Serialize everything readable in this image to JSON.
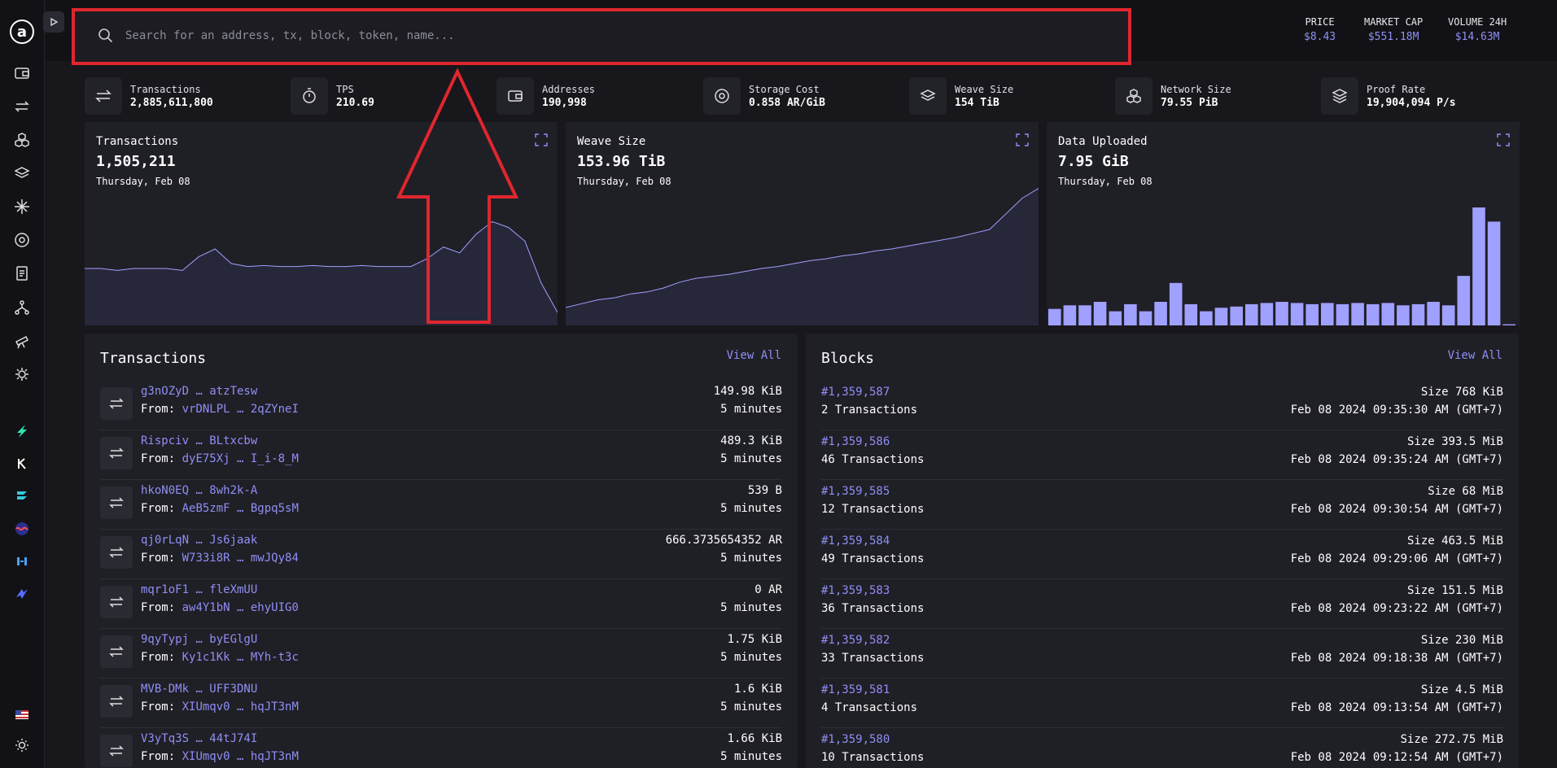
{
  "app": {
    "logo_letter": "a"
  },
  "search": {
    "placeholder": "Search for an address, tx, block, token, name..."
  },
  "market": {
    "price_label": "PRICE",
    "price_value": "$8.43",
    "cap_label": "MARKET CAP",
    "cap_value": "$551.18M",
    "volume_label": "VOLUME 24H",
    "volume_value": "$14.63M"
  },
  "stats": [
    {
      "label": "Transactions",
      "value": "2,885,611,800",
      "icon": "transfer-icon"
    },
    {
      "label": "TPS",
      "value": "210.69",
      "icon": "stopwatch-icon"
    },
    {
      "label": "Addresses",
      "value": "190,998",
      "icon": "wallet-icon"
    },
    {
      "label": "Storage Cost",
      "value": "0.858 AR/GiB",
      "icon": "coin-icon"
    },
    {
      "label": "Weave Size",
      "value": "154 TiB",
      "icon": "layers-icon"
    },
    {
      "label": "Network Size",
      "value": "79.55 PiB",
      "icon": "cubes-icon"
    },
    {
      "label": "Proof Rate",
      "value": "19,904,094 P/s",
      "icon": "proof-icon"
    }
  ],
  "charts": [
    {
      "title": "Transactions",
      "value": "1,505,211",
      "date": "Thursday, Feb 08"
    },
    {
      "title": "Weave Size",
      "value": "153.96 TiB",
      "date": "Thursday, Feb 08"
    },
    {
      "title": "Data Uploaded",
      "value": "7.95 GiB",
      "date": "Thursday, Feb 08"
    }
  ],
  "chart_data": [
    {
      "type": "area",
      "title": "Transactions",
      "values": [
        0.5,
        0.5,
        0.48,
        0.5,
        0.5,
        0.5,
        0.48,
        0.62,
        0.7,
        0.55,
        0.52,
        0.53,
        0.52,
        0.52,
        0.53,
        0.52,
        0.52,
        0.53,
        0.52,
        0.52,
        0.52,
        0.6,
        0.72,
        0.66,
        0.85,
        0.98,
        0.92,
        0.78,
        0.35,
        0.05
      ]
    },
    {
      "type": "area",
      "title": "Weave Size",
      "values": [
        0.1,
        0.14,
        0.18,
        0.2,
        0.24,
        0.26,
        0.3,
        0.36,
        0.4,
        0.42,
        0.44,
        0.47,
        0.5,
        0.52,
        0.55,
        0.58,
        0.6,
        0.63,
        0.65,
        0.68,
        0.7,
        0.73,
        0.76,
        0.79,
        0.82,
        0.86,
        0.9,
        1.06,
        1.22,
        1.32
      ]
    },
    {
      "type": "bar",
      "title": "Data Uploaded",
      "values": [
        14,
        17,
        17,
        20,
        12,
        18,
        12,
        20,
        36,
        18,
        12,
        15,
        16,
        18,
        19,
        20,
        19,
        18,
        19,
        18,
        19,
        18,
        19,
        17,
        18,
        20,
        17,
        42,
        100,
        88,
        1
      ]
    }
  ],
  "transactions_panel": {
    "title": "Transactions",
    "view_all": "View All",
    "rows": [
      {
        "id": "g3nOZyD … atzTesw",
        "from_label": "From:",
        "from": "vrDNLPL … 2qZYneI",
        "size": "149.98 KiB",
        "age": "5 minutes"
      },
      {
        "id": "Rispciv … BLtxcbw",
        "from_label": "From:",
        "from": "dyE75Xj … I_i-8_M",
        "size": "489.3 KiB",
        "age": "5 minutes"
      },
      {
        "id": "hkoN0EQ … 8wh2k-A",
        "from_label": "From:",
        "from": "AeB5zmF … Bgpq5sM",
        "size": "539 B",
        "age": "5 minutes"
      },
      {
        "id": "qj0rLqN … Js6jaak",
        "from_label": "From:",
        "from": "W733i8R … mwJQy84",
        "size": "666.3735654352 AR",
        "age": "5 minutes"
      },
      {
        "id": "mqr1oF1 … fleXmUU",
        "from_label": "From:",
        "from": "aw4Y1bN … ehyUIG0",
        "size": "0 AR",
        "age": "5 minutes"
      },
      {
        "id": "9qyTypj … byEGlgU",
        "from_label": "From:",
        "from": "Ky1c1Kk … MYh-t3c",
        "size": "1.75 KiB",
        "age": "5 minutes"
      },
      {
        "id": "MVB-DMk … UFF3DNU",
        "from_label": "From:",
        "from": "XIUmqv0 … hqJT3nM",
        "size": "1.6 KiB",
        "age": "5 minutes"
      },
      {
        "id": "V3yTq3S … 44tJ74I",
        "from_label": "From:",
        "from": "XIUmqv0 … hqJT3nM",
        "size": "1.66 KiB",
        "age": "5 minutes"
      }
    ]
  },
  "blocks_panel": {
    "title": "Blocks",
    "view_all": "View All",
    "rows": [
      {
        "id": "#1,359,587",
        "count": "2 Transactions",
        "size": "Size 768 KiB",
        "time": "Feb 08 2024 09:35:30 AM (GMT+7)"
      },
      {
        "id": "#1,359,586",
        "count": "46 Transactions",
        "size": "Size 393.5 MiB",
        "time": "Feb 08 2024 09:35:24 AM (GMT+7)"
      },
      {
        "id": "#1,359,585",
        "count": "12 Transactions",
        "size": "Size 68 MiB",
        "time": "Feb 08 2024 09:30:54 AM (GMT+7)"
      },
      {
        "id": "#1,359,584",
        "count": "49 Transactions",
        "size": "Size 463.5 MiB",
        "time": "Feb 08 2024 09:29:06 AM (GMT+7)"
      },
      {
        "id": "#1,359,583",
        "count": "36 Transactions",
        "size": "Size 151.5 MiB",
        "time": "Feb 08 2024 09:23:22 AM (GMT+7)"
      },
      {
        "id": "#1,359,582",
        "count": "33 Transactions",
        "size": "Size 230 MiB",
        "time": "Feb 08 2024 09:18:38 AM (GMT+7)"
      },
      {
        "id": "#1,359,581",
        "count": "4 Transactions",
        "size": "Size 4.5 MiB",
        "time": "Feb 08 2024 09:13:54 AM (GMT+7)"
      },
      {
        "id": "#1,359,580",
        "count": "10 Transactions",
        "size": "Size 272.75 MiB",
        "time": "Feb 08 2024 09:12:54 AM (GMT+7)"
      }
    ]
  },
  "colors": {
    "accent": "#8f8ff5",
    "highlight": "#e0262e",
    "chart_fill": "#27273a",
    "bar": "#a0a0ff"
  }
}
